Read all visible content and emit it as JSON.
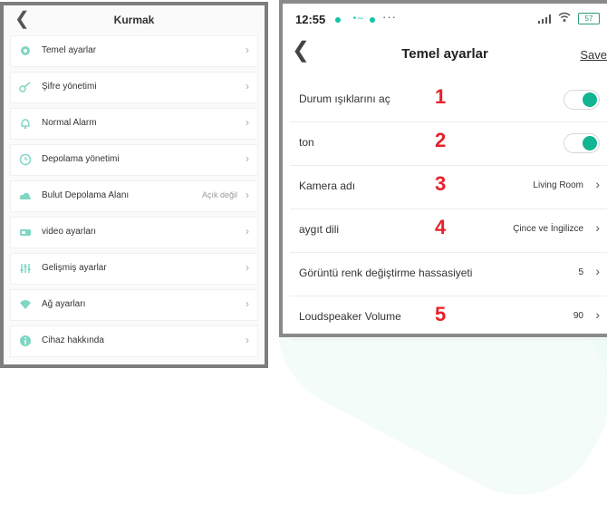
{
  "left": {
    "title": "Kurmak",
    "items": [
      {
        "icon": "gear-icon",
        "label": "Temel ayarlar",
        "value": ""
      },
      {
        "icon": "key-icon",
        "label": "Şifre yönetimi",
        "value": ""
      },
      {
        "icon": "bell-icon",
        "label": "Normal Alarm",
        "value": ""
      },
      {
        "icon": "clock-icon",
        "label": "Depolama yönetimi",
        "value": ""
      },
      {
        "icon": "cloud-icon",
        "label": "Bulut Depolama Alanı",
        "value": "Açık değil"
      },
      {
        "icon": "video-icon",
        "label": "video ayarları",
        "value": ""
      },
      {
        "icon": "sliders-icon",
        "label": "Gelişmiş ayarlar",
        "value": ""
      },
      {
        "icon": "wifi-icon",
        "label": "Ağ ayarları",
        "value": ""
      },
      {
        "icon": "info-icon",
        "label": "Cihaz hakkında",
        "value": ""
      }
    ]
  },
  "right": {
    "status_bar": {
      "time": "12:55",
      "battery": "57"
    },
    "title": "Temel ayarlar",
    "save_label": "Save",
    "rows": [
      {
        "label": "Durum ışıklarını aç",
        "number": "1",
        "type": "toggle",
        "on": true
      },
      {
        "label": "ton",
        "number": "2",
        "type": "toggle",
        "on": true
      },
      {
        "label": "Kamera adı",
        "number": "3",
        "type": "value",
        "value": "Living Room"
      },
      {
        "label": "aygıt dili",
        "number": "4",
        "type": "value",
        "value": "Çince ve İngilizce"
      },
      {
        "label": "Görüntü renk değiştirme hassasiyeti",
        "number": "",
        "type": "value",
        "value": "5"
      },
      {
        "label": "Loudspeaker Volume",
        "number": "5",
        "type": "value",
        "value": "90"
      }
    ]
  },
  "colors": {
    "accent": "#11b591",
    "marker": "#e8202a"
  }
}
